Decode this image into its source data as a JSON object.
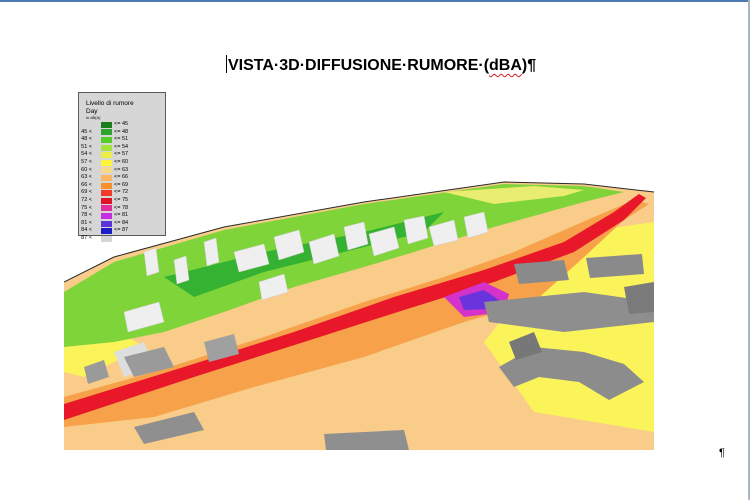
{
  "document": {
    "title_parts": [
      "VISTA·3D·DIFFUSIONE·RUMORE·(",
      "dBA",
      ")¶"
    ],
    "end_mark": "¶"
  },
  "legend": {
    "title": "Livello di rumore",
    "subtitle": "Day",
    "unit": "in dB(A)",
    "entries": [
      {
        "lo": "",
        "hi": "<= 45",
        "color": "#1a7f1a"
      },
      {
        "lo": "45 <",
        "hi": "<= 48",
        "color": "#2fa52f"
      },
      {
        "lo": "48 <",
        "hi": "<= 51",
        "color": "#55cc28"
      },
      {
        "lo": "51 <",
        "hi": "<= 54",
        "color": "#a5e23a"
      },
      {
        "lo": "54 <",
        "hi": "<= 57",
        "color": "#ecec4a"
      },
      {
        "lo": "57 <",
        "hi": "<= 60",
        "color": "#fff23a"
      },
      {
        "lo": "60 <",
        "hi": "<= 63",
        "color": "#f8d98a"
      },
      {
        "lo": "63 <",
        "hi": "<= 66",
        "color": "#f9b561"
      },
      {
        "lo": "66 <",
        "hi": "<= 69",
        "color": "#f78f2b"
      },
      {
        "lo": "69 <",
        "hi": "<= 72",
        "color": "#f23a2a"
      },
      {
        "lo": "72 <",
        "hi": "<= 75",
        "color": "#e0122a"
      },
      {
        "lo": "75 <",
        "hi": "<= 78",
        "color": "#e02f9a"
      },
      {
        "lo": "78 <",
        "hi": "<= 81",
        "color": "#c42ee0"
      },
      {
        "lo": "81 <",
        "hi": "<= 84",
        "color": "#5a36d8"
      },
      {
        "lo": "84 <",
        "hi": "<= 87",
        "color": "#1d1dc8"
      },
      {
        "lo": "87 <",
        "hi": "",
        "color": "#d6d6d6"
      }
    ]
  },
  "map_image": {
    "icon": "noise-map-3d-render",
    "colors": {
      "low": "#55cc28",
      "mid": "#fff23a",
      "road": "#e0122a",
      "building": "#8e8e8e"
    }
  }
}
